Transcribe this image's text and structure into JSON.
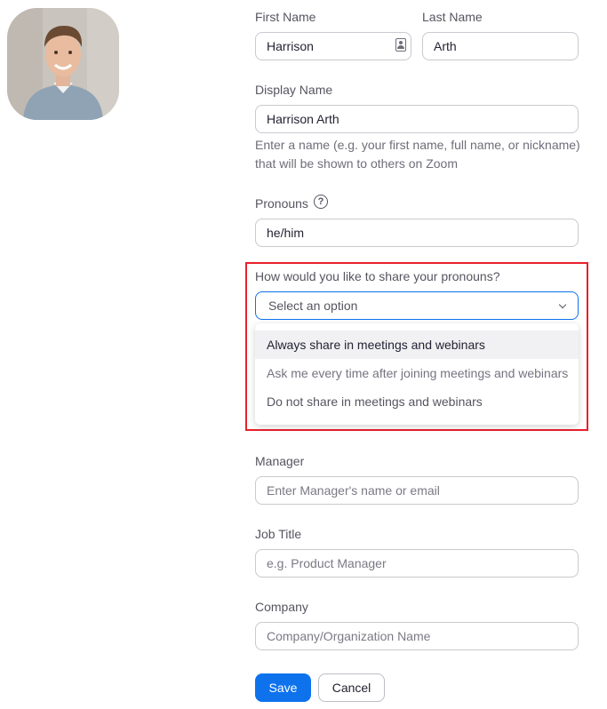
{
  "profile": {
    "first_name": {
      "label": "First Name",
      "value": "Harrison"
    },
    "last_name": {
      "label": "Last Name",
      "value": "Arth"
    },
    "display_name": {
      "label": "Display Name",
      "value": "Harrison Arth",
      "helper": "Enter a name (e.g. your first name, full name, or nickname) that will be shown to others on Zoom"
    },
    "pronouns": {
      "label": "Pronouns",
      "value": "he/him",
      "help_icon": "?"
    },
    "share_pronouns": {
      "label": "How would you like to share your pronouns?",
      "placeholder": "Select an option",
      "options": [
        "Always share in meetings and webinars",
        "Ask me every time after joining meetings and webinars",
        "Do not share in meetings and webinars"
      ]
    },
    "manager": {
      "label": "Manager",
      "placeholder": "Enter Manager's name or email"
    },
    "job_title": {
      "label": "Job Title",
      "placeholder": "e.g. Product Manager"
    },
    "company": {
      "label": "Company",
      "placeholder": "Company/Organization Name"
    }
  },
  "actions": {
    "save": "Save",
    "cancel": "Cancel"
  },
  "colors": {
    "primary": "#0e72ed",
    "highlight": "#e8202a",
    "text": "#232333"
  },
  "icons": {
    "contact": "contact-card-icon",
    "help": "question-circle-icon",
    "chevron": "chevron-down-icon"
  }
}
